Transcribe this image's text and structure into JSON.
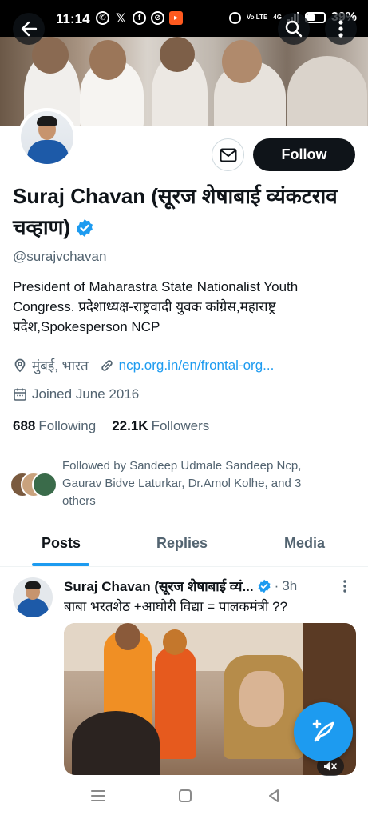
{
  "status_bar": {
    "time": "11:14",
    "battery": "39%",
    "network": "4G",
    "volte_label": "Vo LTE",
    "icons": [
      "whatsapp-icon",
      "x-icon",
      "facebook-icon",
      "vpn-icon",
      "app-notification-icon",
      "alarm-icon",
      "signal-icon",
      "battery-icon"
    ]
  },
  "profile": {
    "display_name": "Suraj Chavan (सूरज शेषाबाई व्यंकटराव चव्हाण)",
    "handle": "@surajvchavan",
    "bio": "President of Maharastra State Nationalist Youth Congress. प्रदेशाध्यक्ष-राष्ट्रवादी युवक कांग्रेस,महाराष्ट्र प्रदेश,Spokesperson NCP",
    "location": "मुंबई, भारत",
    "website": "ncp.org.in/en/frontal-org...",
    "joined": "Joined June 2016",
    "following_count": "688",
    "following_label": "Following",
    "followers_count": "22.1K",
    "followers_label": "Followers",
    "followed_by": "Followed by Sandeep Udmale Sandeep Ncp, Gaurav Bidve Laturkar, Dr.Amol Kolhe, and 3 others",
    "follow_label": "Follow",
    "verified": true
  },
  "tabs": [
    {
      "label": "Posts",
      "active": true
    },
    {
      "label": "Replies",
      "active": false
    },
    {
      "label": "Media",
      "active": false
    }
  ],
  "post": {
    "author": "Suraj Chavan (सूरज शेषाबाई व्यं...",
    "separator": "·",
    "time": "3h",
    "text": "बाबा भरतशेठ +आघोरी विद्या = पालकमंत्री ??"
  },
  "colors": {
    "accent": "#1d9bf0",
    "follow_button": "#0f1419",
    "secondary_text": "#536471"
  }
}
